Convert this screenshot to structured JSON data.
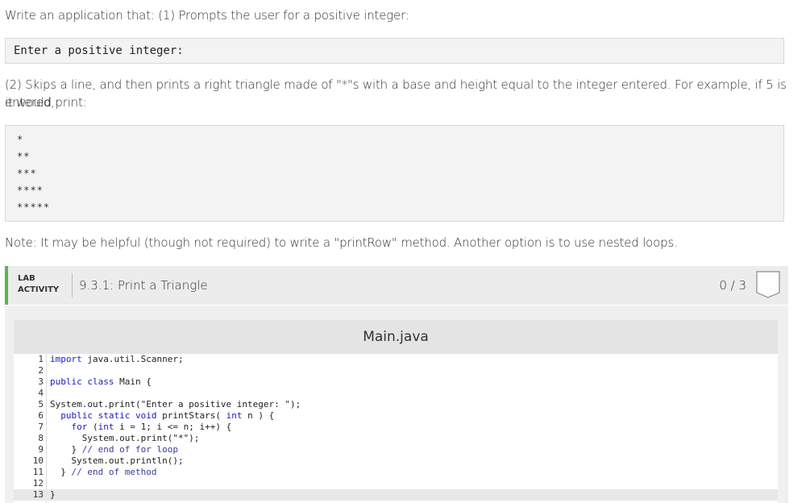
{
  "instructions": {
    "intro": "Write an application that: (1) Prompts the user for a positive integer:",
    "prompt_sample": "Enter a positive integer:",
    "step2_line1": "(2) Skips a line, and then prints a right triangle made of \"*\"s with a base and height equal to the integer entered. For example, if 5 is entered,",
    "step2_line2": "it would print:",
    "stars": [
      "*",
      "**",
      "***",
      "****",
      "*****"
    ],
    "note": "Note: It may be helpful (though not required) to write a \"printRow\" method. Another option is to use nested loops."
  },
  "lab": {
    "tag_line1": "LAB",
    "tag_line2": "ACTIVITY",
    "title": "9.3.1: Print a Triangle",
    "score": "0 / 3"
  },
  "editor": {
    "filename": "Main.java",
    "line_numbers": [
      "1",
      "2",
      "3",
      "4",
      "5",
      "6",
      "7",
      "8",
      "9",
      "10",
      "11",
      "12",
      "13"
    ],
    "lines": [
      "import java.util.Scanner;",
      "",
      "public class Main {",
      "",
      "System.out.print(\"Enter a positive integer: \");",
      "  public static void printStars( int n ) {",
      "    for (int i = 1; i <= n; i++) {",
      "      System.out.print(\"*\");",
      "    } // end of for loop",
      "    System.out.println();",
      "  } // end of method",
      "",
      "}"
    ]
  },
  "colors": {
    "accent_green": "#5ab54b",
    "keyword_blue": "#1b1bc4"
  }
}
